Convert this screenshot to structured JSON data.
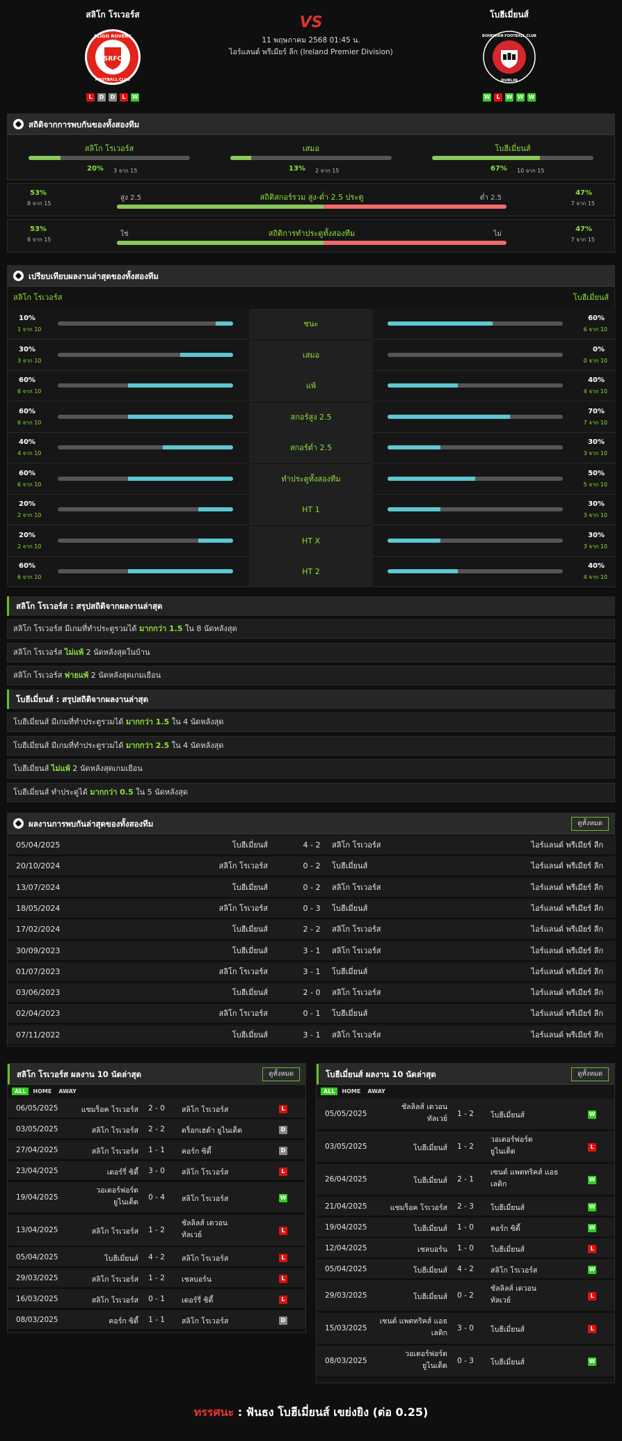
{
  "match": {
    "home": "สลิโก โรเวอร์ส",
    "away": "โบฮีเมี่ยนส์",
    "vs": "VS",
    "datetime": "11 พฤษภาคม 2568 01:45 น.",
    "league": "ไอร์แลนด์ พรีเมียร์ ลีก (Ireland Premier Division)",
    "home_form": [
      "L",
      "D",
      "D",
      "L",
      "W"
    ],
    "away_form": [
      "W",
      "L",
      "W",
      "W",
      "W"
    ],
    "home_logo_text": "SLIGO ROVERS",
    "home_logo_sub": "FOOTBALL CLUB",
    "home_logo_badge": "SRFC",
    "away_logo_text": "BOHEMIAN FOOTBALL CLUB",
    "away_logo_sub": "DUBLIN",
    "colors": {
      "accent": "#8ee03a",
      "red": "#e0322f"
    }
  },
  "h2h_stats": {
    "title": "สถิติจากการพบกันของทั้งสองทีม",
    "home": {
      "label": "สลิโก โรเวอร์ส",
      "pct": "20%",
      "sub": "3 จาก 15",
      "value": 20
    },
    "draw": {
      "label": "เสมอ",
      "pct": "13%",
      "sub": "2 จาก 15",
      "value": 13
    },
    "away": {
      "label": "โบฮีเมี่ยนส์",
      "pct": "67%",
      "sub": "10 จาก 15",
      "value": 67
    },
    "ou": {
      "title": "สถิติสกอร์รวม สูง-ต่ำ 2.5 ประตู",
      "lpct": "53%",
      "lsub": "8 จาก 15",
      "llabel": "สูง 2.5",
      "rpct": "47%",
      "rsub": "7 จาก 15",
      "rlabel": "ต่ำ 2.5",
      "value": 53
    },
    "btts": {
      "title": "สถิติการทำประตูทั้งสองทีม",
      "lpct": "53%",
      "lsub": "8 จาก 15",
      "llabel": "ใช่",
      "rpct": "47%",
      "rsub": "7 จาก 15",
      "rlabel": "ไม่",
      "value": 53
    }
  },
  "compare": {
    "title": "เปรียบเทียบผลงานล่าสุดของทั้งสองทีม",
    "home": "สลิโก โรเวอร์ส",
    "away": "โบฮีเมี่ยนส์",
    "rows": [
      {
        "label": "ชนะ",
        "hp": "10%",
        "hs": "1 จาก 10",
        "hv": 10,
        "ap": "60%",
        "as": "6 จาก 10",
        "av": 60
      },
      {
        "label": "เสมอ",
        "hp": "30%",
        "hs": "3 จาก 10",
        "hv": 30,
        "ap": "0%",
        "as": "0 จาก 10",
        "av": 0
      },
      {
        "label": "แพ้",
        "hp": "60%",
        "hs": "6 จาก 10",
        "hv": 60,
        "ap": "40%",
        "as": "4 จาก 10",
        "av": 40
      },
      {
        "label": "สกอร์สูง 2.5",
        "hp": "60%",
        "hs": "6 จาก 10",
        "hv": 60,
        "ap": "70%",
        "as": "7 จาก 10",
        "av": 70
      },
      {
        "label": "สกอร์ต่ำ 2.5",
        "hp": "40%",
        "hs": "4 จาก 10",
        "hv": 40,
        "ap": "30%",
        "as": "3 จาก 10",
        "av": 30
      },
      {
        "label": "ทำประตูทั้งสองทีม",
        "hp": "60%",
        "hs": "6 จาก 10",
        "hv": 60,
        "ap": "50%",
        "as": "5 จาก 10",
        "av": 50
      },
      {
        "label": "HT 1",
        "hp": "20%",
        "hs": "2 จาก 10",
        "hv": 20,
        "ap": "30%",
        "as": "3 จาก 10",
        "av": 30
      },
      {
        "label": "HT X",
        "hp": "20%",
        "hs": "2 จาก 10",
        "hv": 20,
        "ap": "30%",
        "as": "3 จาก 10",
        "av": 30
      },
      {
        "label": "HT 2",
        "hp": "60%",
        "hs": "6 จาก 10",
        "hv": 60,
        "ap": "40%",
        "as": "4 จาก 10",
        "av": 40
      }
    ]
  },
  "home_summary": {
    "title": "สลิโก โรเวอร์ส : สรุปสถิติจากผลงานล่าสุด",
    "rows": [
      {
        "a": "สลิโก โรเวอร์ส  มีเกมที่ทำประตูรวมได้ ",
        "b": "มากกว่า 1.5",
        "c": " ใน 8 นัดหลังสุด"
      },
      {
        "a": "สลิโก โรเวอร์ส ",
        "b": "ไม่แพ้",
        "c": " 2 นัดหลังสุดในบ้าน"
      },
      {
        "a": "สลิโก โรเวอร์ส ",
        "b": "พ่ายแพ้",
        "c": " 2 นัดหลังสุดเกมเยือน"
      }
    ]
  },
  "away_summary": {
    "title": "โบฮีเมี่ยนส์ : สรุปสถิติจากผลงานล่าสุด",
    "rows": [
      {
        "a": "โบฮีเมี่ยนส์  มีเกมที่ทำประตูรวมได้ ",
        "b": "มากกว่า 1.5",
        "c": " ใน 4 นัดหลังสุด"
      },
      {
        "a": "โบฮีเมี่ยนส์  มีเกมที่ทำประตูรวมได้ ",
        "b": "มากกว่า 2.5",
        "c": " ใน 4 นัดหลังสุด"
      },
      {
        "a": "โบฮีเมี่ยนส์ ",
        "b": "ไม่แพ้",
        "c": " 2 นัดหลังสุดเกมเยือน"
      },
      {
        "a": "โบฮีเมี่ยนส์  ทำประตูได้ ",
        "b": "มากกว่า 0.5",
        "c": " ใน 5 นัดหลังสุด"
      }
    ]
  },
  "h2h": {
    "title": "ผลงานการพบกันล่าสุดของทั้งสองทีม",
    "button": "ดูทั้งหมด",
    "rows": [
      {
        "d": "05/04/2025",
        "h": "โบฮีเมี่ยนส์",
        "s": "4 - 2",
        "a": "สลิโก โรเวอร์ส",
        "l": "ไอร์แลนด์ พรีเมียร์ ลีก"
      },
      {
        "d": "20/10/2024",
        "h": "สลิโก โรเวอร์ส",
        "s": "0 - 2",
        "a": "โบฮีเมี่ยนส์",
        "l": "ไอร์แลนด์ พรีเมียร์ ลีก"
      },
      {
        "d": "13/07/2024",
        "h": "โบฮีเมี่ยนส์",
        "s": "0 - 2",
        "a": "สลิโก โรเวอร์ส",
        "l": "ไอร์แลนด์ พรีเมียร์ ลีก"
      },
      {
        "d": "18/05/2024",
        "h": "สลิโก โรเวอร์ส",
        "s": "0 - 3",
        "a": "โบฮีเมี่ยนส์",
        "l": "ไอร์แลนด์ พรีเมียร์ ลีก"
      },
      {
        "d": "17/02/2024",
        "h": "โบฮีเมี่ยนส์",
        "s": "2 - 2",
        "a": "สลิโก โรเวอร์ส",
        "l": "ไอร์แลนด์ พรีเมียร์ ลีก"
      },
      {
        "d": "30/09/2023",
        "h": "โบฮีเมี่ยนส์",
        "s": "3 - 1",
        "a": "สลิโก โรเวอร์ส",
        "l": "ไอร์แลนด์ พรีเมียร์ ลีก"
      },
      {
        "d": "01/07/2023",
        "h": "สลิโก โรเวอร์ส",
        "s": "3 - 1",
        "a": "โบฮีเมี่ยนส์",
        "l": "ไอร์แลนด์ พรีเมียร์ ลีก"
      },
      {
        "d": "03/06/2023",
        "h": "โบฮีเมี่ยนส์",
        "s": "2 - 0",
        "a": "สลิโก โรเวอร์ส",
        "l": "ไอร์แลนด์ พรีเมียร์ ลีก"
      },
      {
        "d": "02/04/2023",
        "h": "สลิโก โรเวอร์ส",
        "s": "0 - 1",
        "a": "โบฮีเมี่ยนส์",
        "l": "ไอร์แลนด์ พรีเมียร์ ลีก"
      },
      {
        "d": "07/11/2022",
        "h": "โบฮีเมี่ยนส์",
        "s": "3 - 1",
        "a": "สลิโก โรเวอร์ส",
        "l": "ไอร์แลนด์ พรีเมียร์ ลีก"
      }
    ]
  },
  "tabs": [
    "ALL",
    "HOME",
    "AWAY"
  ],
  "home_last": {
    "title": "สลิโก โรเวอร์ส ผลงาน 10 นัดล่าสุด",
    "button": "ดูทั้งหมด",
    "rows": [
      {
        "d": "06/05/2025",
        "h": [
          "แชมร็อค โรเวอร์ส"
        ],
        "s": "2 - 0",
        "a": [
          "สลิโก โรเวอร์ส"
        ],
        "r": "L"
      },
      {
        "d": "03/05/2025",
        "h": [
          "สลิโก โรเวอร์ส"
        ],
        "s": "2 - 2",
        "a": [
          "ดร็อกเฮด้า ยูไนเต็ด"
        ],
        "r": "D"
      },
      {
        "d": "27/04/2025",
        "h": [
          "สลิโก โรเวอร์ส"
        ],
        "s": "1 - 1",
        "a": [
          "คอร์ก ซิตี้"
        ],
        "r": "D"
      },
      {
        "d": "23/04/2025",
        "h": [
          "เดอร์รี่ ซิตี้"
        ],
        "s": "3 - 0",
        "a": [
          "สลิโก โรเวอร์ส"
        ],
        "r": "L"
      },
      {
        "d": "19/04/2025",
        "h": [
          "วอเตอร์ฟอร์ด",
          "ยูไนเต็ด"
        ],
        "s": "0 - 4",
        "a": [
          "สลิโก โรเวอร์ส"
        ],
        "r": "W"
      },
      {
        "d": "13/04/2025",
        "h": [
          "สลิโก โรเวอร์ส"
        ],
        "s": "1 - 2",
        "a": [
          "ชัลลิลส์ เดวอน",
          "ทัลเวย์"
        ],
        "r": "L"
      },
      {
        "d": "05/04/2025",
        "h": [
          "โบฮีเมี่ยนส์"
        ],
        "s": "4 - 2",
        "a": [
          "สลิโก โรเวอร์ส"
        ],
        "r": "L"
      },
      {
        "d": "29/03/2025",
        "h": [
          "สลิโก โรเวอร์ส"
        ],
        "s": "1 - 2",
        "a": [
          "เชลบอร์น"
        ],
        "r": "L"
      },
      {
        "d": "16/03/2025",
        "h": [
          "สลิโก โรเวอร์ส"
        ],
        "s": "0 - 1",
        "a": [
          "เดอร์รี่ ซิตี้"
        ],
        "r": "L"
      },
      {
        "d": "08/03/2025",
        "h": [
          "คอร์ก ซิตี้"
        ],
        "s": "1 - 1",
        "a": [
          "สลิโก โรเวอร์ส"
        ],
        "r": "D"
      }
    ]
  },
  "away_last": {
    "title": "โบฮีเมี่ยนส์ ผลงาน 10 นัดล่าสุด",
    "button": "ดูทั้งหมด",
    "rows": [
      {
        "d": "05/05/2025",
        "h": [
          "ชัลลิลส์ เดวอน",
          "ทัลเวย์"
        ],
        "s": "1 - 2",
        "a": [
          "โบฮีเมี่ยนส์"
        ],
        "r": "W"
      },
      {
        "d": "03/05/2025",
        "h": [
          "โบฮีเมี่ยนส์"
        ],
        "s": "1 - 2",
        "a": [
          "วอเตอร์ฟอร์ด",
          "ยูไนเต็ด"
        ],
        "r": "L"
      },
      {
        "d": "26/04/2025",
        "h": [
          "โบฮีเมี่ยนส์"
        ],
        "s": "2 - 1",
        "a": [
          "เซนต์ แพตทริคส์ แอธ",
          "เลติก"
        ],
        "r": "W"
      },
      {
        "d": "21/04/2025",
        "h": [
          "แชมร็อค โรเวอร์ส"
        ],
        "s": "2 - 3",
        "a": [
          "โบฮีเมี่ยนส์"
        ],
        "r": "W"
      },
      {
        "d": "19/04/2025",
        "h": [
          "โบฮีเมี่ยนส์"
        ],
        "s": "1 - 0",
        "a": [
          "คอร์ก ซิตี้"
        ],
        "r": "W"
      },
      {
        "d": "12/04/2025",
        "h": [
          "เชลบอร์น"
        ],
        "s": "1 - 0",
        "a": [
          "โบฮีเมี่ยนส์"
        ],
        "r": "L"
      },
      {
        "d": "05/04/2025",
        "h": [
          "โบฮีเมี่ยนส์"
        ],
        "s": "4 - 2",
        "a": [
          "สลิโก โรเวอร์ส"
        ],
        "r": "W"
      },
      {
        "d": "29/03/2025",
        "h": [
          "โบฮีเมี่ยนส์"
        ],
        "s": "0 - 2",
        "a": [
          "ชัลลิลส์ เดวอน",
          "ทัลเวย์"
        ],
        "r": "L"
      },
      {
        "d": "15/03/2025",
        "h": [
          "เซนต์ แพตทริคส์ แอธ",
          "เลติก"
        ],
        "s": "3 - 0",
        "a": [
          "โบฮีเมี่ยนส์"
        ],
        "r": "L"
      },
      {
        "d": "08/03/2025",
        "h": [
          "วอเตอร์ฟอร์ด",
          "ยูไนเต็ด"
        ],
        "s": "0 - 3",
        "a": [
          "โบฮีเมี่ยนส์"
        ],
        "r": "W"
      }
    ]
  },
  "tip": {
    "label": "ทรรศนะ",
    "colon": " : ",
    "text": "ฟันธง โบฮีเมี่ยนส์ เขย่งยิง (ต่อ 0.25)"
  }
}
